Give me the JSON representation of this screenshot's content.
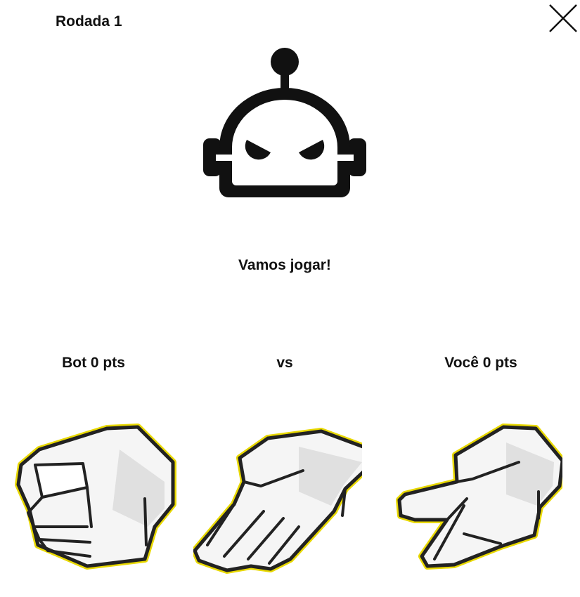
{
  "header": {
    "round_label": "Rodada 1"
  },
  "status_message": "Vamos jogar!",
  "scoreboard": {
    "bot_label": "Bot 0 pts",
    "vs_label": "vs",
    "player_label": "Você 0 pts"
  },
  "opponent": {
    "icon": "robot-icon"
  },
  "choices": [
    {
      "id": "rock",
      "icon": "rock-hand-icon"
    },
    {
      "id": "paper",
      "icon": "paper-hand-icon"
    },
    {
      "id": "scissors",
      "icon": "scissors-hand-icon"
    }
  ],
  "colors": {
    "text": "#111111",
    "hand_fill": "#f5f5f5",
    "hand_outline": "#222222",
    "hand_glow": "#e8d800"
  }
}
